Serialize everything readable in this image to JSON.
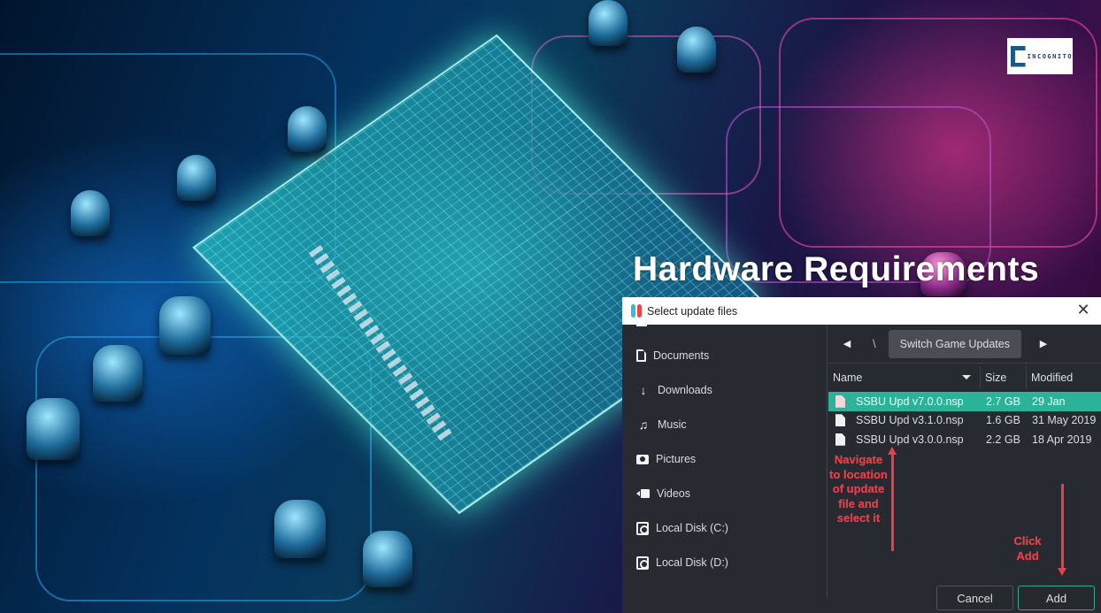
{
  "headline": "Hardware Requirements",
  "logo": {
    "text": "INCOGNITO",
    "brand_color": "#1c5a86"
  },
  "dialog": {
    "title": "Select update files",
    "close_label": "✕",
    "sidebar": {
      "items": [
        {
          "label": "Documents",
          "icon": "document-icon"
        },
        {
          "label": "Downloads",
          "icon": "download-icon"
        },
        {
          "label": "Music",
          "icon": "music-icon"
        },
        {
          "label": "Pictures",
          "icon": "camera-icon"
        },
        {
          "label": "Videos",
          "icon": "video-icon"
        },
        {
          "label": "Local Disk (C:)",
          "icon": "disk-icon"
        },
        {
          "label": "Local Disk (D:)",
          "icon": "disk-icon"
        }
      ]
    },
    "navigation": {
      "back_glyph": "◀",
      "forward_glyph": "▶",
      "separator": "\\",
      "current_folder": "Switch Game Updates"
    },
    "table": {
      "columns": {
        "name": "Name",
        "size": "Size",
        "modified": "Modified"
      },
      "rows": [
        {
          "name": "SSBU Upd v7.0.0.nsp",
          "size": "2.7 GB",
          "modified": "29 Jan",
          "selected": true
        },
        {
          "name": "SSBU Upd v3.1.0.nsp",
          "size": "1.6 GB",
          "modified": "31 May 2019",
          "selected": false
        },
        {
          "name": "SSBU Upd v3.0.0.nsp",
          "size": "2.2 GB",
          "modified": "18 Apr 2019",
          "selected": false
        }
      ],
      "selection_color": "#2bb39a"
    },
    "annotations": {
      "navigate": "Navigate to location of update file and select it",
      "click_add": "Click Add",
      "color": "#e8404a"
    },
    "buttons": {
      "cancel": "Cancel",
      "add": "Add"
    }
  }
}
